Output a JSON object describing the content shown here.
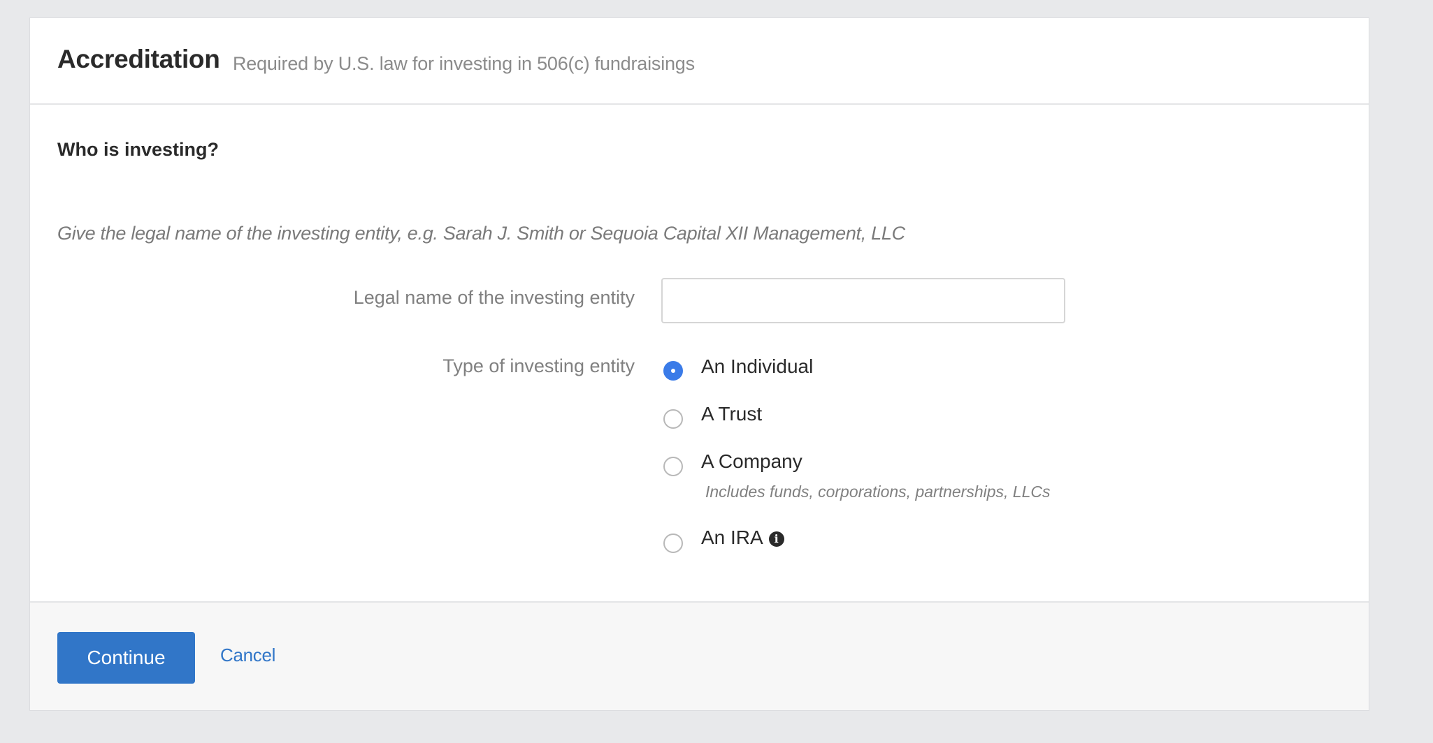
{
  "header": {
    "title": "Accreditation",
    "subtitle": "Required by U.S. law for investing in 506(c) fundraisings"
  },
  "section": {
    "title": "Who is investing?",
    "hint": "Give the legal name of the investing entity, e.g. Sarah J. Smith or Sequoia Capital XII Management, LLC"
  },
  "form": {
    "legal_name_label": "Legal name of the investing entity",
    "legal_name_value": "",
    "legal_name_placeholder": "",
    "entity_type_label": "Type of investing entity",
    "entity_type_selected": "An Individual",
    "options": [
      {
        "label": "An Individual",
        "checked": true
      },
      {
        "label": "A Trust",
        "checked": false
      },
      {
        "label": "A Company",
        "checked": false,
        "note": "Includes funds, corporations, partnerships, LLCs"
      },
      {
        "label": "An IRA",
        "checked": false,
        "icon": "info-icon"
      }
    ]
  },
  "footer": {
    "continue_label": "Continue",
    "cancel_label": "Cancel"
  },
  "colors": {
    "accent": "#3176c8",
    "radio_selected": "#3a7be8",
    "background": "#e8e9eb"
  }
}
